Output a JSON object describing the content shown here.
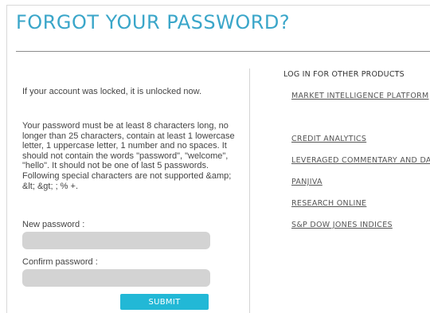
{
  "page": {
    "title": "FORGOT YOUR PASSWORD?",
    "accent_color": "#3aa6c9",
    "button_color": "#22b8d6"
  },
  "form": {
    "unlock_message": "If your account was locked, it is unlocked now.",
    "rules_message": "Your password must be at least 8 characters long, no longer than 25 characters, contain at least 1 lowercase letter, 1 uppercase letter, 1 number and no spaces. It should not contain the words \"password\", \"welcome\", \"hello\". It should not be one of last 5 passwords. Following special characters are not supported &amp; &lt; &gt; ; % +.",
    "new_password_label": "New password :",
    "new_password_value": "",
    "confirm_password_label": "Confirm password :",
    "confirm_password_value": "",
    "submit_label": "SUBMIT"
  },
  "products": {
    "heading": "LOG IN FOR OTHER PRODUCTS",
    "links": [
      {
        "label": "MARKET INTELLIGENCE PLATFORM"
      },
      {
        "label": "CREDIT ANALYTICS"
      },
      {
        "label": "LEVERAGED COMMENTARY AND DATA"
      },
      {
        "label": "PANJIVA"
      },
      {
        "label": "RESEARCH ONLINE"
      },
      {
        "label": "S&P DOW JONES INDICES"
      }
    ]
  }
}
